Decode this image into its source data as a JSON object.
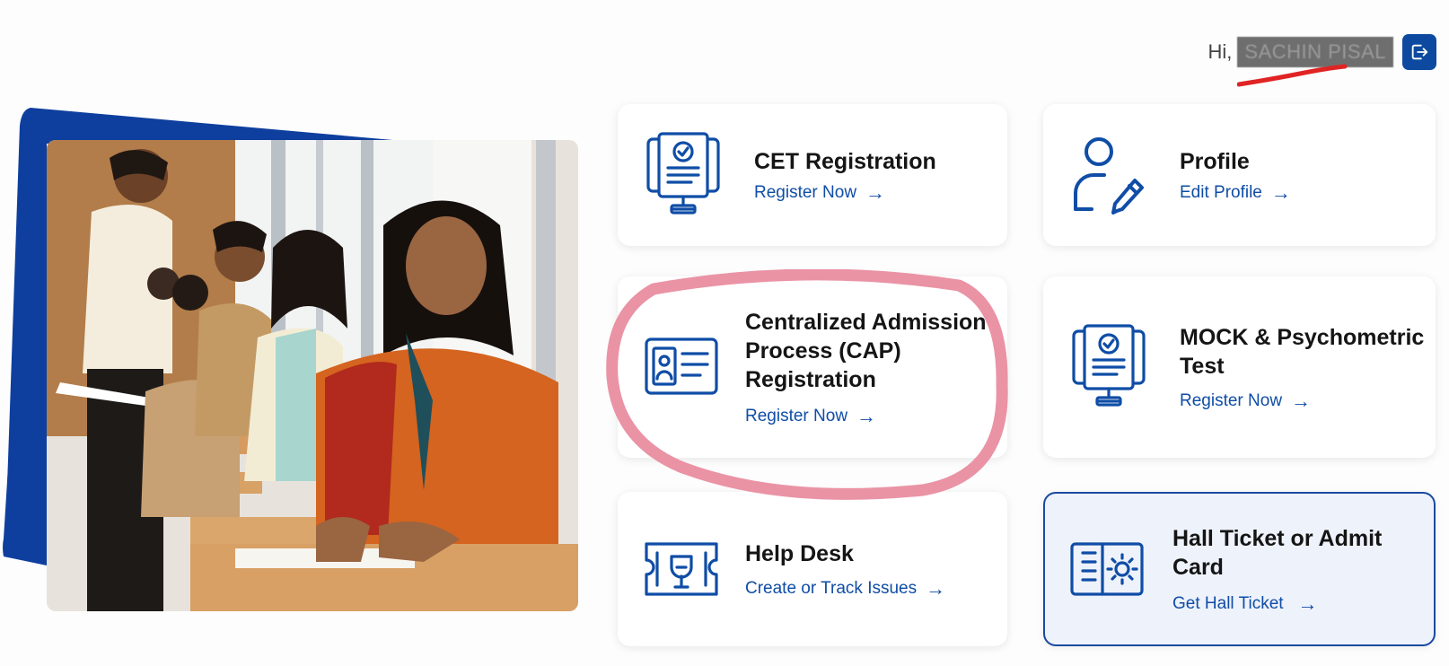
{
  "header": {
    "greeting": "Hi,",
    "user_name": "SACHIN PISAL"
  },
  "cards": {
    "cet": {
      "title": "CET Registration",
      "link": "Register Now",
      "icon": "exam-monitor-icon"
    },
    "profile": {
      "title": "Profile",
      "link": "Edit Profile",
      "icon": "user-edit-icon"
    },
    "cap": {
      "title_lines": [
        "Centralized Admission",
        "Process (CAP)",
        "Registration"
      ],
      "link": "Register Now",
      "icon": "id-card-icon"
    },
    "mock": {
      "title_lines": [
        "MOCK & Psychometric",
        "Test"
      ],
      "link": "Register Now",
      "icon": "exam-monitor-icon"
    },
    "help": {
      "title": "Help Desk",
      "link": "Create or Track Issues",
      "icon": "support-ticket-icon"
    },
    "hall": {
      "title_lines": [
        "Hall Ticket or Admit",
        "Card"
      ],
      "link": "Get Hall Ticket",
      "icon": "ticket-gear-icon"
    }
  },
  "arrow_glyph": "→",
  "colors": {
    "primary": "#0d4a9f",
    "link": "#0f4da6",
    "annotation": "#e98da0",
    "scribble": "#e02424"
  }
}
